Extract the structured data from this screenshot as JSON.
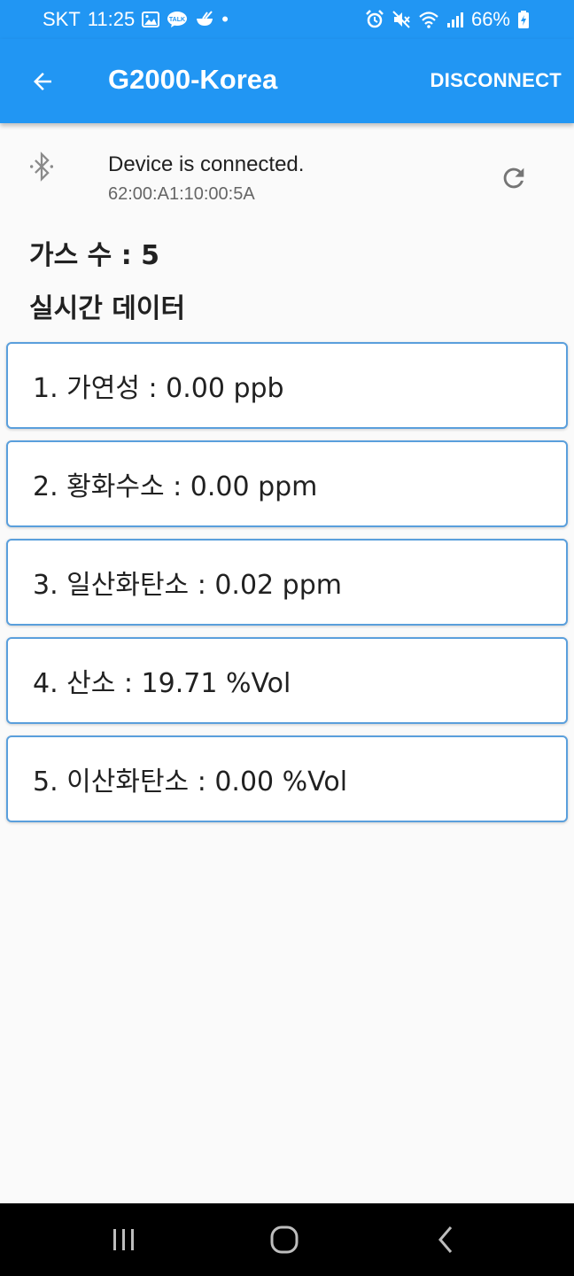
{
  "status_bar": {
    "carrier": "SKT",
    "time": "11:25",
    "notification_icons": [
      "gallery-icon",
      "kakaotalk-icon",
      "bowl-icon",
      "dot-icon"
    ],
    "kakao_label": "TALK",
    "dot": "•",
    "system_icons": [
      "alarm-icon",
      "mute-icon",
      "wifi-icon",
      "signal-icon",
      "battery-charging-icon"
    ],
    "battery": "66%"
  },
  "app_bar": {
    "title": "G2000-Korea",
    "disconnect_label": "DISCONNECT",
    "color": "#2196f3"
  },
  "device": {
    "status": "Device is connected.",
    "address": "62:00:A1:10:00:5A"
  },
  "gas_count_label": "가스 수 : 5",
  "section_title": "실시간 데이터",
  "gas_readings": [
    {
      "text": "1. 가연성 : 0.00 ppb"
    },
    {
      "text": "2. 황화수소 : 0.00 ppm"
    },
    {
      "text": "3. 일산화탄소 : 0.02 ppm"
    },
    {
      "text": "4. 산소 : 19.71 %Vol"
    },
    {
      "text": "5. 이산화탄소 : 0.00 %Vol"
    }
  ],
  "nav_bar": {
    "buttons": [
      "recents-icon",
      "home-icon",
      "back-icon"
    ]
  }
}
